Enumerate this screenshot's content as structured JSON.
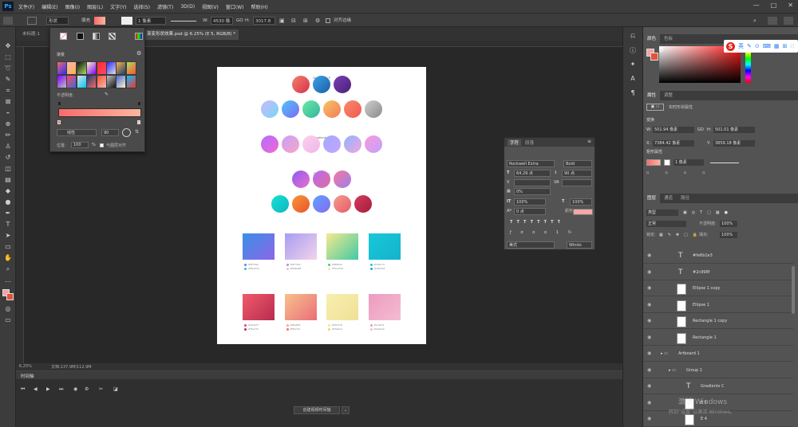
{
  "app": {
    "logo": "Ps"
  },
  "menu": [
    "文件(F)",
    "编辑(E)",
    "图像(I)",
    "图层(L)",
    "文字(Y)",
    "选择(S)",
    "滤镜(T)",
    "3D(D)",
    "视图(V)",
    "窗口(W)",
    "帮助(H)"
  ],
  "window_controls": [
    "—",
    "□",
    "✕"
  ],
  "options": {
    "shape_label": "形状",
    "fill_label": "填充",
    "stroke_width": "1 像素",
    "w_label": "W:",
    "w_value": "4530 像",
    "link": "GO",
    "h_label": "H:",
    "h_value": "3017.8",
    "align_label": "对齐边缘"
  },
  "tabs": [
    {
      "label": "未标题-1"
    },
    {
      "label": "渐变形状效果.psd @ 6.25% (E 5, RGB/8) *"
    }
  ],
  "status": {
    "zoom": "6.25%",
    "doc": "文档:137.9M/112.9M"
  },
  "timeline": {
    "title": "时间轴",
    "create_button": "创建视频时间轴"
  },
  "gradient_panel": {
    "title": "渐变",
    "opacity_label": "不透明度:",
    "mode_label": "线性",
    "angle": "90",
    "position_label": "位置:",
    "position_value": "100",
    "percent": "%",
    "reverse_label": "与图层对齐",
    "presets": [
      "#f26b6b",
      "#f7b5b5",
      "#111111",
      "#fff3c4",
      "#ff2d2d",
      "#2b2bff",
      "#ffb347",
      "#a8e063",
      "#7f00ff",
      "#fc466b",
      "#e0e0e0",
      "#1e3c72",
      "#ff512f",
      "#c0c0c0",
      "#4568dc",
      "#00c6ff"
    ],
    "bar_from": "#f76b6b",
    "bar_to": "#fcb69f"
  },
  "artboard": {
    "groups": [
      {
        "title": "Gradients P",
        "colors": [
          [
            "#f0826b",
            "#d9314d"
          ],
          [
            "#3fa2e3",
            "#185fa8"
          ],
          [
            "#7a3fb0",
            "#4b1f7c"
          ]
        ]
      },
      {
        "title": "",
        "colors": [
          [
            "#c8b8ff",
            "#7ad7f0"
          ],
          [
            "#4fc3f7",
            "#7b6cf6"
          ],
          [
            "#6fe8a0",
            "#2fb5a0"
          ],
          [
            "#f6c463",
            "#f47b5b"
          ],
          [
            "#f98b6b",
            "#f0584f"
          ],
          [
            "#cfcfcf",
            "#8a8a8a"
          ]
        ]
      },
      {
        "title": "Gradients V",
        "colors": [
          [
            "#b36cff",
            "#f06ad0"
          ],
          [
            "#c9a2f7",
            "#f6a4c8"
          ],
          [
            "#fbd0e8",
            "#f0b6ec"
          ],
          [
            "#a2a8ff",
            "#c5a6ff"
          ],
          [
            "#8fb4ff",
            "#f0a6e0"
          ],
          [
            "#f49bd8",
            "#c5a0ff"
          ]
        ]
      },
      {
        "title": "Gradients J",
        "colors": [
          [
            "#8b5cf6",
            "#ec6ec8"
          ],
          [
            "#b56cf0",
            "#e06c9f"
          ],
          [
            "#f27c9a",
            "#a07cf0"
          ]
        ]
      },
      {
        "title": "",
        "colors": [
          [
            "#13e3d0",
            "#0fb5c4"
          ],
          [
            "#f7973a",
            "#e8542a"
          ],
          [
            "#5aa4ff",
            "#8a68f0"
          ],
          [
            "#f59b8b",
            "#e65c6a"
          ],
          [
            "#d23b5c",
            "#a81c3c"
          ]
        ]
      }
    ],
    "squares_row1": [
      {
        "from": "#3a8fe8",
        "to": "#8c66e6",
        "labels": [
          "#8f7d9e",
          "#86a5d4"
        ]
      },
      {
        "from": "#a79df2",
        "to": "#f2d3ea",
        "labels": [
          "#8f7d9e",
          "#8a6a88"
        ]
      },
      {
        "from": "#f5e98e",
        "to": "#42c9a4",
        "labels": [
          "#8f6bae",
          "#7be3d6"
        ]
      },
      {
        "from": "#18c8d8",
        "to": "#14b3cc",
        "labels": [
          "#18acc5",
          "#18b3a4"
        ]
      }
    ],
    "squares_row2": [
      {
        "from": "#f05a6c",
        "to": "#b82c4e",
        "labels": [
          "#d0a9f7",
          "#f5e215"
        ]
      },
      {
        "from": "#f7c28b",
        "to": "#e96e7a",
        "labels": [
          "#f8a8b5",
          "#f8a79c"
        ]
      },
      {
        "from": "#f6efb0",
        "to": "#f1e096",
        "labels": [
          "#f0c978",
          "#f0e9e4"
        ]
      },
      {
        "from": "#ec9cc0",
        "to": "#f4bcd0",
        "labels": [
          "#ec9fc8",
          "#ebb4dc"
        ]
      }
    ],
    "square_dot_colors": [
      [
        "#6a7ef0",
        "#2fc0d0"
      ],
      [
        "#a38cf0",
        "#f2c0d8"
      ],
      [
        "#43c9a0",
        "#f5e98e"
      ],
      [
        "#17c6d6",
        "#14b0c8"
      ]
    ],
    "square_dot_colors2": [
      [
        "#e0476a",
        "#b82c4e"
      ],
      [
        "#f7a77a",
        "#e96e7a"
      ],
      [
        "#f4e39a",
        "#f0d07a"
      ],
      [
        "#ec9cc0",
        "#f4bcd0"
      ]
    ]
  },
  "char_panel": {
    "tabs": [
      "字符",
      "段落"
    ],
    "font": "Rockwell Extra",
    "style": "Bold",
    "size": "64.29 点",
    "leading": "90 点",
    "tracking": "0%",
    "vscale": "100%",
    "hscale": "100%",
    "baseline": "0 点",
    "color_label": "颜色:",
    "color": "#f4a8a8",
    "lang": "美式",
    "aa": "Windo"
  },
  "right": {
    "color_tabs": [
      "颜色",
      "色板"
    ],
    "props_tabs": [
      "属性",
      "调整"
    ],
    "props_title": "实时形状属性",
    "transform": "变换",
    "w_label": "W:",
    "w_value": "501.94 像素",
    "h_label": "H:",
    "h_value": "501.01 像素",
    "go_label": "GO",
    "x_label": "X:",
    "x_value": "7384.42 像素",
    "y_label": "Y:",
    "y_value": "3859.18 像素",
    "shape_section": "矩形属性",
    "stroke": "1 像素",
    "layers_tabs": [
      "图层",
      "通道",
      "路径"
    ],
    "kind": "类型",
    "blend": "正常",
    "opacity_label": "不透明度:",
    "opacity": "100%",
    "fill_label": "填充:",
    "fill": "100%",
    "lock_label": "锁定:",
    "layers": [
      {
        "name": "#fe6b1e3",
        "type": "text",
        "indent": 1
      },
      {
        "name": "#2c998f",
        "type": "text",
        "indent": 1
      },
      {
        "name": "Ellipse 1 copy",
        "type": "shape",
        "indent": 1
      },
      {
        "name": "Ellipse 1",
        "type": "shape",
        "indent": 1
      },
      {
        "name": "Rectangle 1 copy",
        "type": "shape",
        "indent": 1
      },
      {
        "name": "Rectangle 1",
        "type": "shape",
        "indent": 1
      },
      {
        "name": "Artboard 1",
        "type": "group",
        "indent": 0
      },
      {
        "name": "Group 1",
        "type": "group",
        "indent": 1
      },
      {
        "name": "Gradients C",
        "type": "text",
        "indent": 2
      },
      {
        "name": "E 5",
        "type": "shape",
        "indent": 2
      },
      {
        "name": "E 4",
        "type": "shape",
        "indent": 2
      }
    ]
  },
  "watermark": {
    "line1": "激活 Windows",
    "line2": "转到“设置”以激活 Windows。"
  },
  "ime": {
    "s": "S",
    "items": [
      "英",
      "✎",
      "⊙",
      "⌨",
      "▦",
      "⊞",
      "∷"
    ]
  }
}
